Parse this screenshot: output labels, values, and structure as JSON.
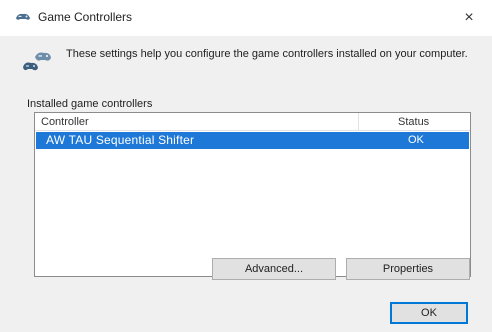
{
  "window": {
    "title": "Game Controllers",
    "close_glyph": "×",
    "title_icon": "game-controller-icon"
  },
  "info": {
    "icon": "game-controllers-icon",
    "text": "These settings help you configure the game controllers installed on your computer."
  },
  "group": {
    "label": "Installed game controllers"
  },
  "list": {
    "columns": [
      "Controller",
      "Status"
    ],
    "rows": [
      {
        "name": "AW TAU Sequential Shifter",
        "status": "OK",
        "selected": true
      }
    ],
    "selection_color": "#1e78d7"
  },
  "buttons": {
    "advanced": "Advanced...",
    "properties": "Properties",
    "ok": "OK"
  }
}
